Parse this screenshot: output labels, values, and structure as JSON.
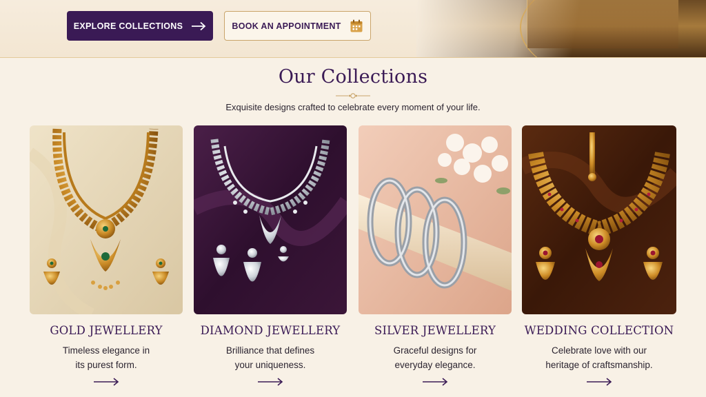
{
  "hero": {
    "explore_label": "EXPLORE COLLECTIONS",
    "appointment_label": "BOOK AN APPOINTMENT"
  },
  "collections": {
    "title": "Our Collections",
    "subtitle": "Exquisite designs crafted to celebrate every moment of your life.",
    "cards": [
      {
        "title": "GOLD JEWELLERY",
        "desc_line1": "Timeless elegance in",
        "desc_line2": "its purest form."
      },
      {
        "title": "DIAMOND JEWELLERY",
        "desc_line1": "Brilliance that defines",
        "desc_line2": "your uniqueness."
      },
      {
        "title": "SILVER JEWELLERY",
        "desc_line1": "Graceful designs for",
        "desc_line2": "everyday elegance."
      },
      {
        "title": "WEDDING COLLECTION",
        "desc_line1": "Celebrate love with our",
        "desc_line2": "heritage of craftsmanship."
      }
    ]
  },
  "colors": {
    "brand_purple": "#3a1a55",
    "accent_gold": "#c9a46a",
    "background": "#f8f1e6"
  },
  "icons": [
    "arrow-right-icon",
    "calendar-icon",
    "ornament-icon"
  ]
}
